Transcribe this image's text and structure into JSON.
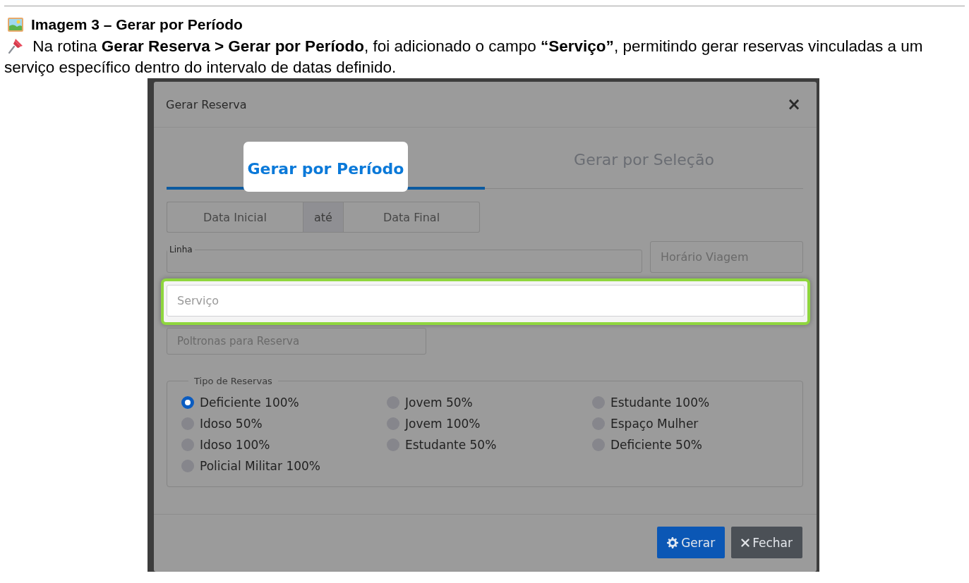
{
  "document": {
    "heading": "Imagem 3 – Gerar por Período",
    "note": "Na rotina **Gerar Reserva > Gerar por Período**, foi adicionado o campo **“Serviço”**, permitindo gerar reservas vinculadas a um serviço específico dentro do intervalo de datas definido."
  },
  "dialog": {
    "title": "Gerar Reserva",
    "close": "×",
    "tabs": [
      {
        "label": "Gerar por Período",
        "selected": true,
        "highlighted": true
      },
      {
        "label": "Gerar por Seleção",
        "selected": false,
        "highlighted": false
      }
    ],
    "date_range": {
      "start_placeholder": "Data Inicial",
      "separator": "até",
      "end_placeholder": "Data Final"
    },
    "line_field": {
      "label": "Linha"
    },
    "time_field": {
      "placeholder": "Horário Viagem"
    },
    "service_field": {
      "placeholder": "Serviço",
      "highlighted": true
    },
    "seats_field": {
      "placeholder": "Poltronas para Reserva"
    },
    "reservation_types": {
      "legend": "Tipo de Reservas",
      "options": [
        {
          "label": "Deficiente 100%",
          "selected": true
        },
        {
          "label": "Jovem 50%",
          "selected": false
        },
        {
          "label": "Estudante 100%",
          "selected": false
        },
        {
          "label": "Idoso 50%",
          "selected": false
        },
        {
          "label": "Jovem 100%",
          "selected": false
        },
        {
          "label": "Espaço Mulher",
          "selected": false
        },
        {
          "label": "Idoso 100%",
          "selected": false
        },
        {
          "label": "Estudante 50%",
          "selected": false
        },
        {
          "label": "Deficiente 50%",
          "selected": false
        },
        {
          "label": "Policial Militar 100%",
          "selected": false
        }
      ]
    },
    "buttons": [
      {
        "label": "Gerar",
        "kind": "primary"
      },
      {
        "label": "Fechar",
        "kind": "secondary"
      }
    ]
  }
}
